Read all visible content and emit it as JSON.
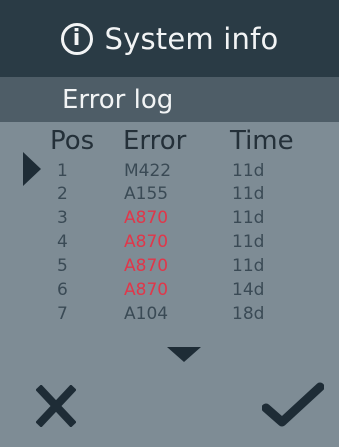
{
  "header": {
    "icon": "info-icon",
    "icon_glyph": "i",
    "title": "System info"
  },
  "subheader": {
    "title": "Error log"
  },
  "table": {
    "columns": [
      "Pos",
      "Error",
      "Time"
    ],
    "rows": [
      {
        "pos": "1",
        "error": "M422",
        "time": "11d",
        "highlight": false
      },
      {
        "pos": "2",
        "error": "A155",
        "time": "11d",
        "highlight": false
      },
      {
        "pos": "3",
        "error": "A870",
        "time": "11d",
        "highlight": true
      },
      {
        "pos": "4",
        "error": "A870",
        "time": "11d",
        "highlight": true
      },
      {
        "pos": "5",
        "error": "A870",
        "time": "11d",
        "highlight": true
      },
      {
        "pos": "6",
        "error": "A870",
        "time": "14d",
        "highlight": true
      },
      {
        "pos": "7",
        "error": "A104",
        "time": "18d",
        "highlight": false
      }
    ],
    "selected_row": 1
  },
  "icons": {
    "selection": "row-pointer-icon",
    "scroll": "scroll-down-icon",
    "cancel": "close-icon",
    "confirm": "checkmark-icon"
  },
  "colors": {
    "header_bg": "#2a3b45",
    "subheader_bg": "#4e5d67",
    "body_bg": "#7e8c95",
    "highlight_error": "#e0374a",
    "dark_icon": "#1e2c36"
  }
}
